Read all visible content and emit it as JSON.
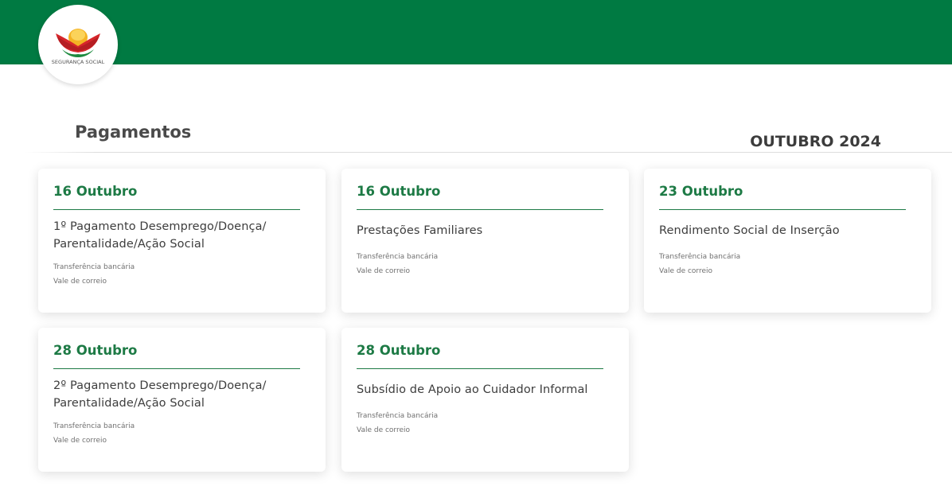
{
  "header": {
    "brand_color": "#007a42",
    "logo": {
      "icon": "seguranca-social-logo",
      "text": "SEGURANÇA SOCIAL"
    }
  },
  "page": {
    "title": "Pagamentos",
    "month": "OUTUBRO 2024"
  },
  "accent_color": "#1d7a45",
  "cards": [
    {
      "date": "16 Outubro",
      "title_lines": [
        "1º Pagamento Desemprego/Doença/",
        "Parentalidade/Ação Social"
      ],
      "methods": [
        "Transferência bancária",
        "Vale de correio"
      ]
    },
    {
      "date": "16 Outubro",
      "title_lines": [
        "Prestações Familiares"
      ],
      "methods": [
        "Transferência bancária",
        "Vale de correio"
      ]
    },
    {
      "date": "23 Outubro",
      "title_lines": [
        "Rendimento Social de Inserção"
      ],
      "methods": [
        "Transferência bancária",
        "Vale de correio"
      ]
    },
    {
      "date": "28 Outubro",
      "title_lines": [
        "2º Pagamento Desemprego/Doença/",
        "Parentalidade/Ação Social"
      ],
      "methods": [
        "Transferência bancária",
        "Vale de correio"
      ]
    },
    {
      "date": "28 Outubro",
      "title_lines": [
        "Subsídio de Apoio ao Cuidador Informal"
      ],
      "methods": [
        "Transferência bancária",
        "Vale de correio"
      ]
    }
  ]
}
